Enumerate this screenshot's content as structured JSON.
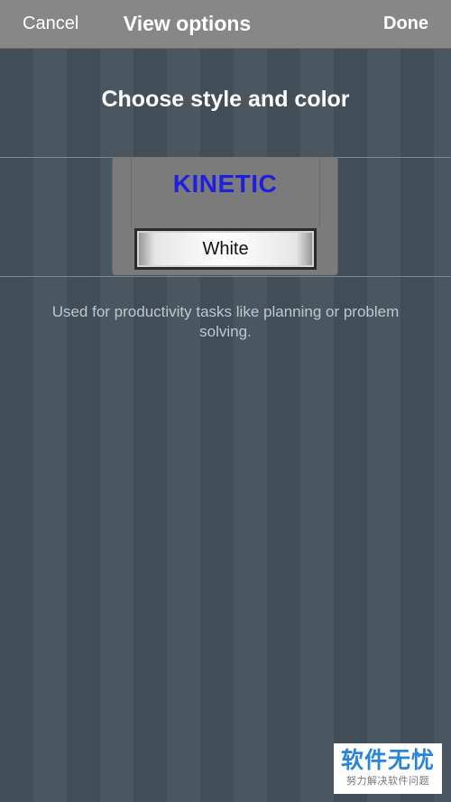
{
  "nav": {
    "cancel_label": "Cancel",
    "title": "View options",
    "done_label": "Done"
  },
  "main": {
    "heading": "Choose style and color",
    "style_name": "KINETIC",
    "color_label": "White",
    "description": "Used for productivity tasks like planning or problem solving."
  },
  "watermark": {
    "main": "软件无忧",
    "sub": "努力解决软件问题"
  },
  "colors": {
    "nav_bg": "#878787",
    "background_dark": "#414d57",
    "background_light": "#4a5760",
    "style_name_color": "#1f1fe0"
  }
}
